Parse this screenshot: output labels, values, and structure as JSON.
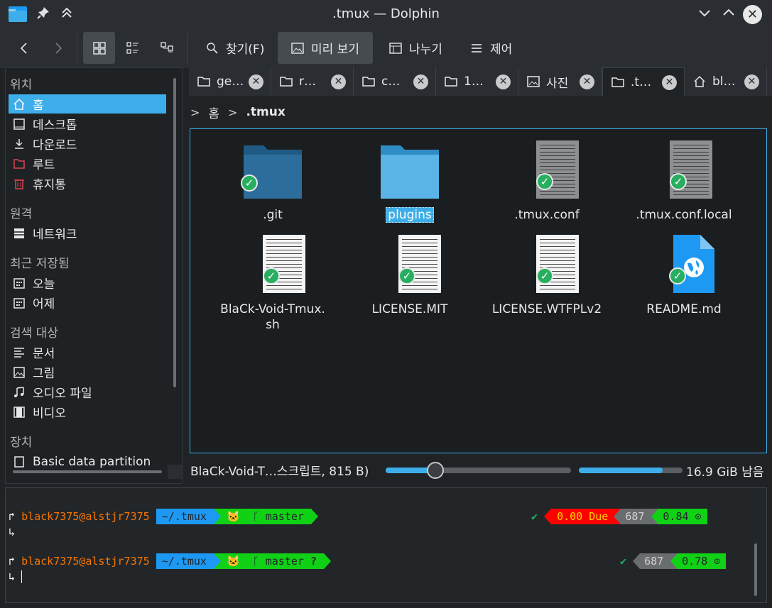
{
  "window": {
    "title": ".tmux — Dolphin"
  },
  "toolbar": {
    "find_label": "찾기(F)",
    "preview_label": "미리 보기",
    "split_label": "나누기",
    "control_label": "제어"
  },
  "sidebar": {
    "places_header": "위치",
    "places": [
      {
        "label": "홈",
        "icon": "home-icon",
        "selected": true
      },
      {
        "label": "데스크톱",
        "icon": "desktop-icon"
      },
      {
        "label": "다운로드",
        "icon": "download-icon"
      },
      {
        "label": "루트",
        "icon": "root-folder-icon"
      },
      {
        "label": "휴지통",
        "icon": "trash-icon"
      }
    ],
    "remote_header": "원격",
    "remote": [
      {
        "label": "네트워크",
        "icon": "network-icon"
      }
    ],
    "recent_header": "최근 저장됨",
    "recent": [
      {
        "label": "오늘",
        "icon": "calendar-icon"
      },
      {
        "label": "어제",
        "icon": "calendar-icon"
      }
    ],
    "search_header": "검색 대상",
    "search": [
      {
        "label": "문서",
        "icon": "document-icon"
      },
      {
        "label": "그림",
        "icon": "image-icon"
      },
      {
        "label": "오디오 파일",
        "icon": "music-icon"
      },
      {
        "label": "비디오",
        "icon": "video-icon"
      }
    ],
    "devices_header": "장치",
    "devices": [
      {
        "label": "Basic data partition",
        "icon": "drive-icon"
      }
    ]
  },
  "tabs": [
    {
      "label": "ge…",
      "icon": "folder-icon"
    },
    {
      "label": "r…",
      "icon": "folder-icon"
    },
    {
      "label": "c…",
      "icon": "folder-icon"
    },
    {
      "label": "1…",
      "icon": "folder-icon"
    },
    {
      "label": "사진",
      "icon": "image-icon"
    },
    {
      "label": ".t…",
      "icon": "folder-icon",
      "active": true
    },
    {
      "label": "bl…",
      "icon": "home-icon"
    }
  ],
  "breadcrumb": {
    "home": "홈",
    "current": ".tmux"
  },
  "files": [
    {
      "name": ".git",
      "kind": "folder-dark"
    },
    {
      "name": "plugins",
      "kind": "folder",
      "selected": true
    },
    {
      "name": ".tmux.conf",
      "kind": "text-gray"
    },
    {
      "name": ".tmux.conf.local",
      "kind": "text-gray"
    },
    {
      "name_line1": "BlaCk-Void-Tmux.",
      "name_line2": "sh",
      "kind": "text-white"
    },
    {
      "name": "LICENSE.MIT",
      "kind": "text-white"
    },
    {
      "name": "LICENSE.WTFPLv2",
      "kind": "text-white"
    },
    {
      "name": "README.md",
      "kind": "markdown"
    }
  ],
  "status": {
    "info": "BlaCk-Void-T…스크립트, 815 B)",
    "zoom_level": 0.27,
    "space_used": 0.81,
    "free_space": "16.9 GiB 남음"
  },
  "terminal": {
    "lines": [
      {
        "user": "black7375@alstjr7375",
        "path": "~/.tmux",
        "branch": "master",
        "due": "0.00 Due",
        "count": "687",
        "load": "0.84"
      },
      {
        "user": "black7375@alstjr7375",
        "path": "~/.tmux",
        "branch": "master",
        "branch_status": "?",
        "count": "687",
        "load": "0.78"
      }
    ],
    "prompt_arrow": "↱",
    "continue_arrow": "↳",
    "check": "✔"
  },
  "colors": {
    "accent": "#3daee9",
    "terminal_green": "#11d116",
    "terminal_blue": "#1d99f3",
    "terminal_red": "#ff0000",
    "user_orange": "#f67400"
  }
}
